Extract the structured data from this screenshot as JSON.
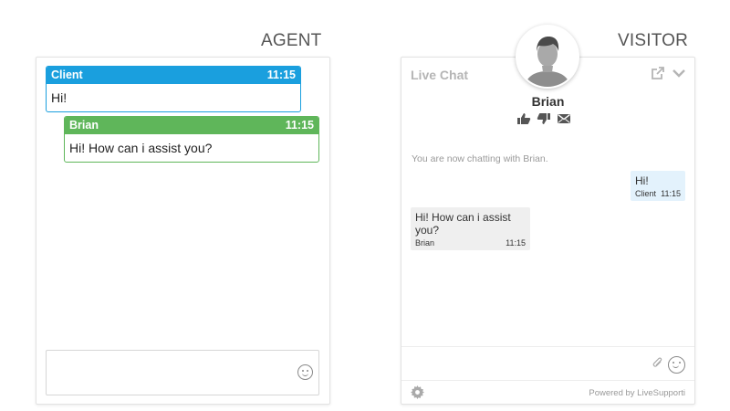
{
  "headings": {
    "agent": "AGENT",
    "visitor": "VISITOR"
  },
  "agent": {
    "messages": [
      {
        "sender": "Client",
        "time": "11:15",
        "text": "Hi!",
        "color": "#1a9fde"
      },
      {
        "sender": "Brian",
        "time": "11:15",
        "text": "Hi! How can i assist you?",
        "color": "#5fb65a"
      }
    ],
    "input": {
      "value": "",
      "placeholder": ""
    },
    "emoji_icon": "smiley-icon"
  },
  "visitor": {
    "title": "Live Chat",
    "top_icons": [
      "popout-icon",
      "chevron-down-icon"
    ],
    "operator_name": "Brian",
    "rating_icons": [
      "thumbs-up-icon",
      "thumbs-down-icon",
      "envelope-icon"
    ],
    "system_message": "You are now chatting with Brian.",
    "messages": [
      {
        "sender": "Client",
        "time": "11:15",
        "text": "Hi!",
        "color": "#e3f2fc"
      },
      {
        "sender": "Brian",
        "time": "11:15",
        "text": "Hi! How can i assist you?",
        "color": "#efefef"
      }
    ],
    "input": {
      "value": "",
      "placeholder": ""
    },
    "powered_by": "Powered by LiveSupporti"
  }
}
